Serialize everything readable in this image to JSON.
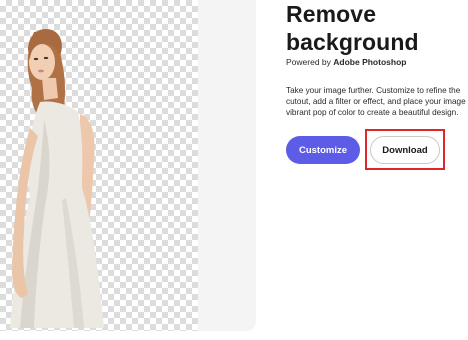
{
  "header": {
    "title_line1": "Remove",
    "title_line2": "background",
    "powered_prefix": "Powered by",
    "powered_brand": "Adobe Photoshop"
  },
  "description": "Take your image further. Customize to refine the cutout, add a filter or effect, and place your image vibrant pop of color to create a beautiful design.",
  "actions": {
    "customize_label": "Customize",
    "download_label": "Download"
  },
  "colors": {
    "customize_bg": "#5d5ce6",
    "highlight": "#e0262b"
  },
  "preview": {
    "image_icon": "person-cutout-image"
  }
}
